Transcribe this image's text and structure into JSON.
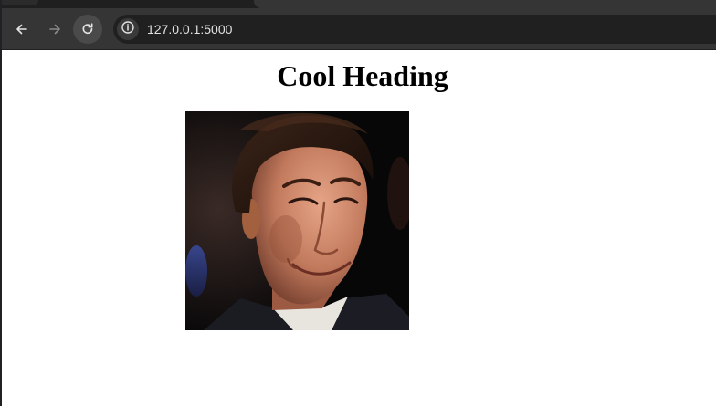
{
  "browser": {
    "address_bar": {
      "url": "127.0.0.1:5000",
      "site_info_icon": "info-icon"
    },
    "toolbar": {
      "back_icon": "arrow-left-icon",
      "forward_icon": "arrow-right-icon",
      "reload_icon": "reload-icon"
    }
  },
  "page": {
    "heading": "Cool Heading",
    "image": {
      "subject": "photo-of-smiling-man-in-suit"
    }
  },
  "colors": {
    "toolbar_bg": "#353535",
    "omnibox_bg": "#202020",
    "url_text": "#e3e3e3",
    "page_bg": "#ffffff",
    "heading_text": "#000000"
  }
}
